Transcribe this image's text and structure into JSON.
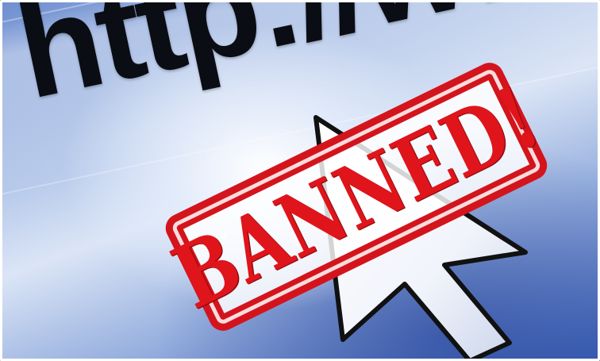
{
  "image": {
    "url_text": "http://www",
    "stamp_text": "BANNED!",
    "colors": {
      "stamp_red": "#d4141c",
      "url_text": "#0b0d14",
      "background_blue": "#3f63b8",
      "cursor_fill": "#ffffff",
      "cursor_outline": "#111111"
    },
    "icons": {
      "cursor": "mouse-pointer-arrow-icon"
    }
  }
}
